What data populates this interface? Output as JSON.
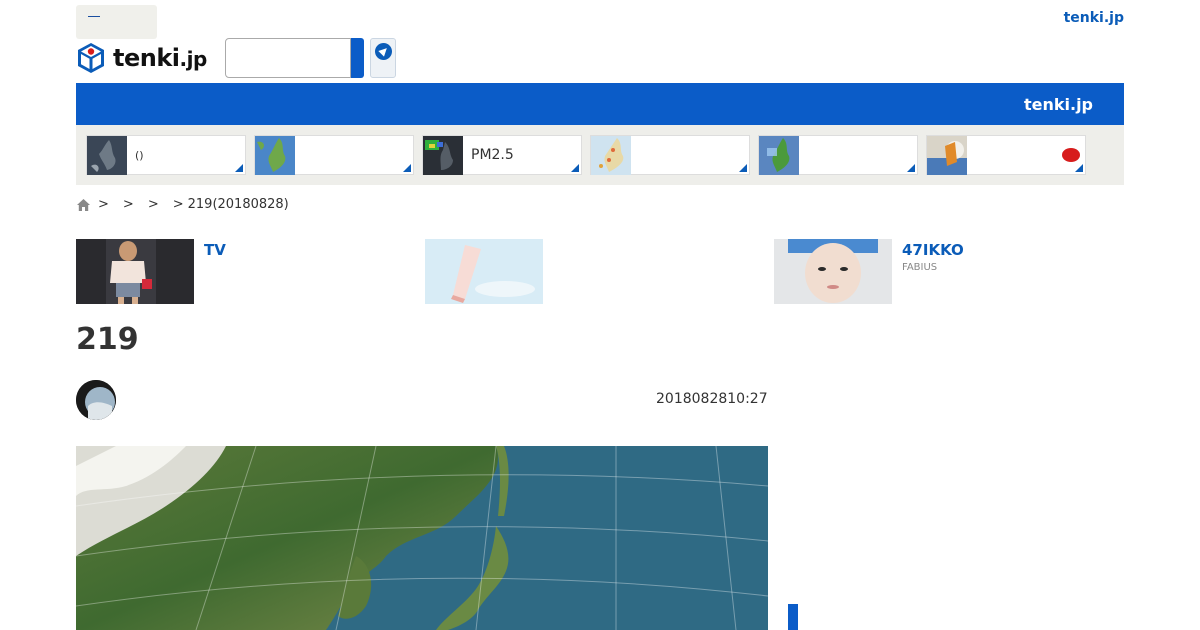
{
  "header": {
    "brand_link": "tenki.jp",
    "logo_main": "tenki",
    "logo_suffix": ".jp",
    "search_placeholder": ""
  },
  "nav": {
    "brand": "tenki.jp"
  },
  "tiles": [
    {
      "label": "()",
      "icon": "satellite-thumbnail"
    },
    {
      "label": "",
      "icon": "japan-map-thumbnail"
    },
    {
      "label": "PM2.5",
      "icon": "pm25-map-thumbnail"
    },
    {
      "label": "",
      "icon": "weather-map-thumbnail"
    },
    {
      "label": "",
      "icon": "radar-map-thumbnail"
    },
    {
      "label": "",
      "icon": "mascot-thumbnail"
    }
  ],
  "breadcrumb": {
    "separators": [
      ">",
      ">",
      ">",
      ">"
    ],
    "current": "219(20180828)"
  },
  "promos": [
    {
      "title": "TV",
      "subtitle": ""
    },
    {
      "title": "",
      "subtitle": ""
    },
    {
      "title": "47IKKO",
      "subtitle": "FABIUS"
    }
  ],
  "article": {
    "title": "219",
    "date": "2018082810:27"
  },
  "colors": {
    "brand_blue": "#0b5cc8",
    "link_blue": "#0b5cb8",
    "tile_band_bg": "#eeeeea"
  }
}
